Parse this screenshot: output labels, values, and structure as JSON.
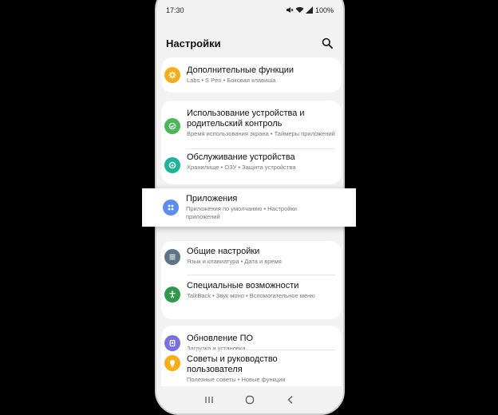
{
  "status": {
    "time": "17:30",
    "battery": "100%"
  },
  "header": {
    "title": "Настройки"
  },
  "groups": [
    {
      "items": [
        {
          "title": "Дополнительные функции",
          "subtitle": "Labs • S Pen • Боковая клавиша",
          "icon": "advanced-features-icon",
          "color": "#f6ad1b"
        }
      ]
    },
    {
      "items": [
        {
          "title": "Использование устройства и родительский контроль",
          "subtitle": "Время использования экрана • Таймеры приложений",
          "icon": "digital-wellbeing-icon",
          "color": "#4cb55a"
        },
        {
          "title": "Обслуживание устройства",
          "subtitle": "Хранилище • ОЗУ • Защита устройства",
          "icon": "device-care-icon",
          "color": "#1db39a"
        }
      ]
    },
    {
      "items": [
        {
          "title": "Приложения",
          "subtitle": "Приложения по умолчанию • Настройки приложений",
          "icon": "apps-icon",
          "color": "#5b8def"
        }
      ]
    },
    {
      "items": [
        {
          "title": "Общие настройки",
          "subtitle": "Язык и клавиатура • Дата и время",
          "icon": "general-management-icon",
          "color": "#5e7489"
        },
        {
          "title": "Специальные возможности",
          "subtitle": "TalkBack • Звук моно • Вспомогательное меню",
          "icon": "accessibility-icon",
          "color": "#2e9b4a"
        }
      ]
    },
    {
      "items": [
        {
          "title": "Обновление ПО",
          "subtitle": "Загрузка и установка",
          "icon": "software-update-icon",
          "color": "#7b6fe0"
        },
        {
          "title": "Советы и руководство пользователя",
          "subtitle": "Полезные советы • Новые функции",
          "icon": "tips-icon",
          "color": "#f6ad1b"
        }
      ]
    }
  ]
}
